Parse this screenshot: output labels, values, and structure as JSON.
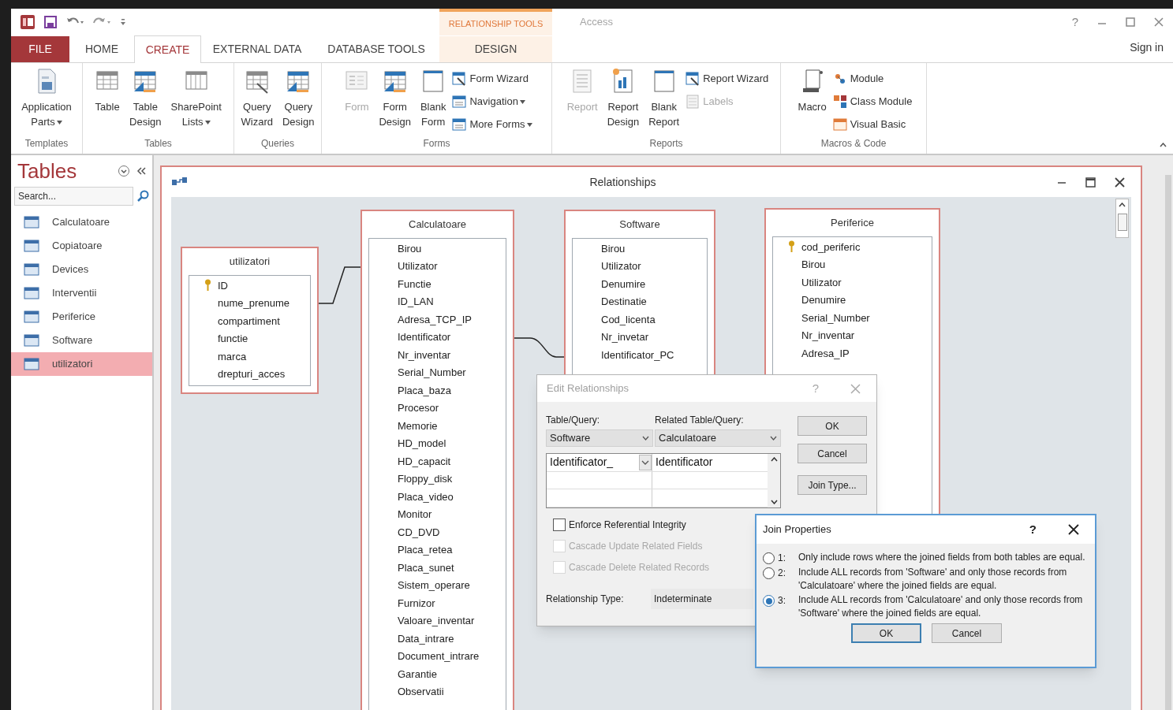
{
  "title_bar": {
    "context_header": "RELATIONSHIP TOOLS",
    "app": "Access",
    "help": "?"
  },
  "tabs": [
    {
      "label": "FILE",
      "kind": "file",
      "selected": false
    },
    {
      "label": "HOME",
      "kind": "normal",
      "selected": false
    },
    {
      "label": "CREATE",
      "kind": "normal",
      "selected": true
    },
    {
      "label": "EXTERNAL DATA",
      "kind": "normal",
      "selected": false
    },
    {
      "label": "DATABASE TOOLS",
      "kind": "normal",
      "selected": false
    },
    {
      "label": "DESIGN",
      "kind": "context",
      "selected": false
    }
  ],
  "sign_in": "Sign in",
  "ribbon_groups": [
    {
      "name": "Templates",
      "items": [
        {
          "label": "Application Parts",
          "kind": "large",
          "dropdown": true,
          "disabled": false
        }
      ]
    },
    {
      "name": "Tables",
      "items": [
        {
          "label": "Table",
          "kind": "large",
          "dropdown": false,
          "disabled": false
        },
        {
          "label": "Table Design",
          "kind": "large",
          "dropdown": false,
          "disabled": false
        },
        {
          "label": "SharePoint Lists",
          "kind": "large",
          "dropdown": true,
          "disabled": false
        }
      ]
    },
    {
      "name": "Queries",
      "items": [
        {
          "label": "Query Wizard",
          "kind": "large",
          "dropdown": false,
          "disabled": false
        },
        {
          "label": "Query Design",
          "kind": "large",
          "dropdown": false,
          "disabled": false
        }
      ]
    },
    {
      "name": "Forms",
      "items": [
        {
          "label": "Form",
          "kind": "large",
          "dropdown": false,
          "disabled": true
        },
        {
          "label": "Form Design",
          "kind": "large",
          "dropdown": false,
          "disabled": false
        },
        {
          "label": "Blank Form",
          "kind": "large",
          "dropdown": false,
          "disabled": false
        },
        {
          "label": "Form Wizard",
          "kind": "small",
          "dropdown": false,
          "disabled": false
        },
        {
          "label": "Navigation",
          "kind": "small",
          "dropdown": true,
          "disabled": false
        },
        {
          "label": "More Forms",
          "kind": "small",
          "dropdown": true,
          "disabled": false
        }
      ]
    },
    {
      "name": "Reports",
      "items": [
        {
          "label": "Report",
          "kind": "large",
          "dropdown": false,
          "disabled": true
        },
        {
          "label": "Report Design",
          "kind": "large",
          "dropdown": false,
          "disabled": false
        },
        {
          "label": "Blank Report",
          "kind": "large",
          "dropdown": false,
          "disabled": false
        },
        {
          "label": "Report Wizard",
          "kind": "small",
          "dropdown": false,
          "disabled": false
        },
        {
          "label": "Labels",
          "kind": "small",
          "dropdown": false,
          "disabled": true
        }
      ]
    },
    {
      "name": "Macros & Code",
      "items": [
        {
          "label": "Macro",
          "kind": "large",
          "dropdown": false,
          "disabled": false
        },
        {
          "label": "Module",
          "kind": "small",
          "dropdown": false,
          "disabled": false
        },
        {
          "label": "Class Module",
          "kind": "small",
          "dropdown": false,
          "disabled": false
        },
        {
          "label": "Visual Basic",
          "kind": "small",
          "dropdown": false,
          "disabled": false
        }
      ]
    }
  ],
  "nav": {
    "title": "Tables",
    "search": {
      "placeholder": "Search..."
    },
    "items": [
      {
        "label": "Calculatoare",
        "selected": false
      },
      {
        "label": "Copiatoare",
        "selected": false
      },
      {
        "label": "Devices",
        "selected": false
      },
      {
        "label": "Interventii",
        "selected": false
      },
      {
        "label": "Periferice",
        "selected": false
      },
      {
        "label": "Software",
        "selected": false
      },
      {
        "label": "utilizatori",
        "selected": true
      }
    ]
  },
  "relationships": {
    "title": "Relationships",
    "tables": [
      {
        "name": "utilizatori",
        "fields": [
          {
            "name": "ID",
            "key": true
          },
          {
            "name": "nume_prenume",
            "key": false
          },
          {
            "name": "compartiment",
            "key": false
          },
          {
            "name": "functie",
            "key": false
          },
          {
            "name": "marca",
            "key": false
          },
          {
            "name": "drepturi_acces",
            "key": false
          }
        ]
      },
      {
        "name": "Calculatoare",
        "fields": [
          {
            "name": "Birou",
            "key": false
          },
          {
            "name": "Utilizator",
            "key": false
          },
          {
            "name": "Functie",
            "key": false
          },
          {
            "name": "ID_LAN",
            "key": false
          },
          {
            "name": "Adresa_TCP_IP",
            "key": false
          },
          {
            "name": "Identificator",
            "key": false
          },
          {
            "name": "Nr_inventar",
            "key": false
          },
          {
            "name": "Serial_Number",
            "key": false
          },
          {
            "name": "Placa_baza",
            "key": false
          },
          {
            "name": "Procesor",
            "key": false
          },
          {
            "name": "Memorie",
            "key": false
          },
          {
            "name": "HD_model",
            "key": false
          },
          {
            "name": "HD_capacit",
            "key": false
          },
          {
            "name": "Floppy_disk",
            "key": false
          },
          {
            "name": "Placa_video",
            "key": false
          },
          {
            "name": "Monitor",
            "key": false
          },
          {
            "name": "CD_DVD",
            "key": false
          },
          {
            "name": "Placa_retea",
            "key": false
          },
          {
            "name": "Placa_sunet",
            "key": false
          },
          {
            "name": "Sistem_operare",
            "key": false
          },
          {
            "name": "Furnizor",
            "key": false
          },
          {
            "name": "Valoare_inventar",
            "key": false
          },
          {
            "name": "Data_intrare",
            "key": false
          },
          {
            "name": "Document_intrare",
            "key": false
          },
          {
            "name": "Garantie",
            "key": false
          },
          {
            "name": "Observatii",
            "key": false
          }
        ]
      },
      {
        "name": "Software",
        "fields": [
          {
            "name": "Birou",
            "key": false
          },
          {
            "name": "Utilizator",
            "key": false
          },
          {
            "name": "Denumire",
            "key": false
          },
          {
            "name": "Destinatie",
            "key": false
          },
          {
            "name": "Cod_licenta",
            "key": false
          },
          {
            "name": "Nr_invetar",
            "key": false
          },
          {
            "name": "Identificator_PC",
            "key": false
          }
        ]
      },
      {
        "name": "Periferice",
        "fields": [
          {
            "name": "cod_periferic",
            "key": true
          },
          {
            "name": "Birou",
            "key": false
          },
          {
            "name": "Utilizator",
            "key": false
          },
          {
            "name": "Denumire",
            "key": false
          },
          {
            "name": "Serial_Number",
            "key": false
          },
          {
            "name": "Nr_inventar",
            "key": false
          },
          {
            "name": "Adresa_IP",
            "key": false
          }
        ]
      }
    ]
  },
  "edit_dialog": {
    "title": "Edit Relationships",
    "help": "?",
    "table_label": "Table/Query:",
    "related_label": "Related Table/Query:",
    "table_value": "Software",
    "related_value": "Calculatoare",
    "rows": [
      {
        "field": "Identificator_",
        "related": "Identificator"
      }
    ],
    "options": [
      {
        "label": "Enforce Referential Integrity",
        "checked": false,
        "disabled": false
      },
      {
        "label": "Cascade Update Related Fields",
        "checked": false,
        "disabled": true
      },
      {
        "label": "Cascade Delete Related Records",
        "checked": false,
        "disabled": true
      }
    ],
    "type_label": "Relationship Type:",
    "type_value": "Indeterminate",
    "buttons": [
      "OK",
      "Cancel",
      "Join Type..."
    ]
  },
  "join_dialog": {
    "title": "Join Properties",
    "help": "?",
    "options": [
      {
        "number": "1:",
        "text": "Only include rows where the joined fields from both tables are equal.",
        "selected": false
      },
      {
        "number": "2:",
        "text": "Include ALL records from 'Software' and only those records from 'Calculatoare' where the joined fields are equal.",
        "selected": false
      },
      {
        "number": "3:",
        "text": "Include ALL records from 'Calculatoare' and only those records from 'Software' where the joined fields are equal.",
        "selected": true
      }
    ],
    "buttons": [
      {
        "label": "OK",
        "focused": true
      },
      {
        "label": "Cancel",
        "focused": false
      }
    ]
  }
}
